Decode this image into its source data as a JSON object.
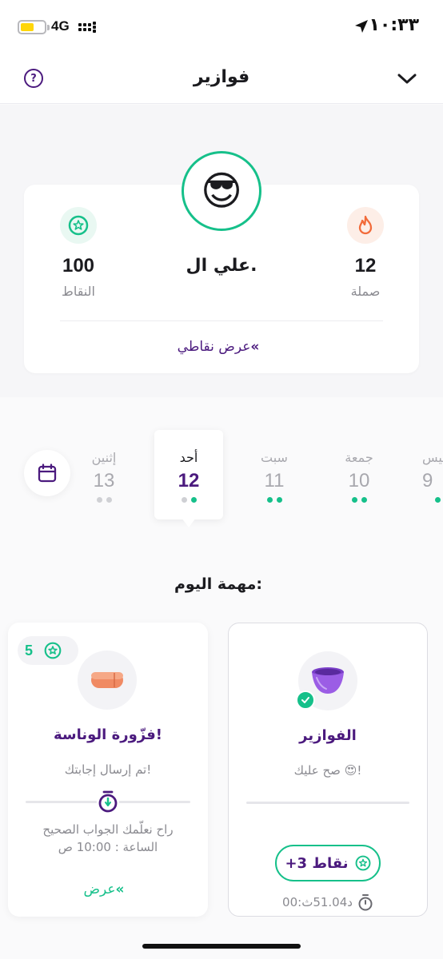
{
  "status_bar": {
    "time": "١٠:٣٣",
    "network": "4G"
  },
  "header": {
    "title": "فوازير",
    "help_symbol": "?"
  },
  "profile": {
    "avatar_emoji": "😎",
    "name": "علي ال.",
    "points_value": "100",
    "points_label": "النقاط",
    "streak_value": "12",
    "streak_label": "صملة",
    "view_points_link": "عرض نقاطي",
    "link_arrow": "«"
  },
  "days": [
    {
      "name": "إثنين",
      "number": "13",
      "dots": [
        "gray",
        "gray"
      ],
      "active": false
    },
    {
      "name": "أحد",
      "number": "12",
      "dots": [
        "gray",
        "green"
      ],
      "active": true
    },
    {
      "name": "سبت",
      "number": "11",
      "dots": [
        "green",
        "green"
      ],
      "active": false
    },
    {
      "name": "جمعة",
      "number": "10",
      "dots": [
        "green",
        "green"
      ],
      "active": false
    },
    {
      "name": "خميس",
      "number": "9",
      "dots": [
        "green"
      ],
      "active": false
    }
  ],
  "section_title": "مهمة اليوم:",
  "quiz_card": {
    "title": "الفوازير",
    "status": "صح عليك 😍!",
    "reward_label": "+3  نقاط",
    "timer": "00:د51.04ث"
  },
  "riddle_card": {
    "points": "5",
    "title": "فزّورة الوناسة!",
    "status": "تم إرسال إجابتك!",
    "reveal_line1": "راح نعلّمك الجواب الصحيح",
    "reveal_line2": "الساعة : 10:00 ص",
    "view_link": "عرض",
    "link_arrow": "«"
  },
  "colors": {
    "primary": "#4b1a7e",
    "accent": "#16c08a",
    "streak": "#f26b3a"
  }
}
